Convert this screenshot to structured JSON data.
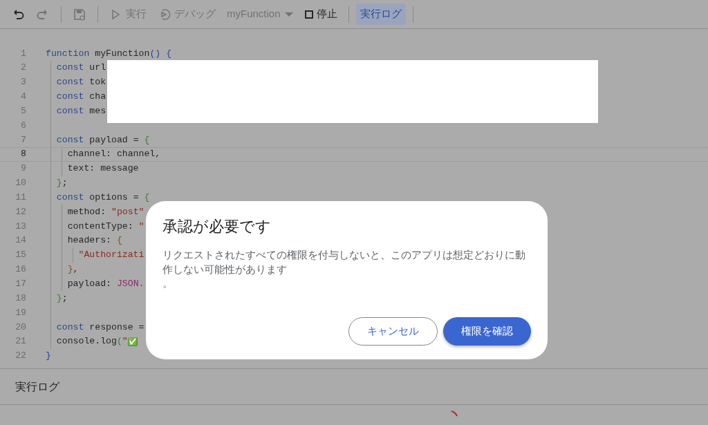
{
  "toolbar": [
    {
      "kind": "undo",
      "disabled": false
    },
    {
      "kind": "redo",
      "disabled": true
    },
    {
      "kind": "separator"
    },
    {
      "kind": "save",
      "disabled": true
    },
    {
      "kind": "separator"
    },
    {
      "kind": "run",
      "label": "実行",
      "disabled": true
    },
    {
      "kind": "debug",
      "label": "デバッグ",
      "disabled": true
    },
    {
      "kind": "function-select",
      "label": "myFunction",
      "disabled": true
    },
    {
      "kind": "stop",
      "label": "停止",
      "disabled": false
    },
    {
      "kind": "separator"
    },
    {
      "kind": "log",
      "label": "実行ログ",
      "on": true
    },
    {
      "kind": "separator"
    }
  ],
  "editor": {
    "lines": [
      {
        "number": "1",
        "current": false,
        "tokens": [
          {
            "text": "function",
            "kind": "keyword"
          },
          {
            "text": " myFunction",
            "kind": "plain"
          },
          {
            "text": "()",
            "kind": "brace1"
          },
          {
            "text": " {",
            "kind": "brace1"
          }
        ]
      },
      {
        "number": "2",
        "current": false,
        "tokens": [
          {
            "text": "  const",
            "kind": "keyword"
          },
          {
            "text": " url",
            "kind": "plain"
          }
        ]
      },
      {
        "number": "3",
        "current": false,
        "tokens": [
          {
            "text": "  const",
            "kind": "keyword"
          },
          {
            "text": " tok",
            "kind": "plain"
          }
        ]
      },
      {
        "number": "4",
        "current": false,
        "tokens": [
          {
            "text": "  const",
            "kind": "keyword"
          },
          {
            "text": " cha",
            "kind": "plain"
          }
        ]
      },
      {
        "number": "5",
        "current": false,
        "tokens": [
          {
            "text": "  const",
            "kind": "keyword"
          },
          {
            "text": " mes",
            "kind": "plain"
          }
        ]
      },
      {
        "number": "6",
        "current": false
      },
      {
        "number": "7",
        "current": false,
        "tokens": [
          {
            "text": "  const",
            "kind": "keyword"
          },
          {
            "text": " payload =",
            "kind": "plain"
          },
          {
            "text": " {",
            "kind": "brace2"
          }
        ]
      },
      {
        "number": "8",
        "current": true,
        "tokens": [
          {
            "text": "    channel: channel,",
            "kind": "plain"
          }
        ]
      },
      {
        "number": "9",
        "current": false,
        "tokens": [
          {
            "text": "    text: message",
            "kind": "plain"
          }
        ]
      },
      {
        "number": "10",
        "current": false,
        "tokens": [
          {
            "text": "  }",
            "kind": "brace2"
          },
          {
            "text": ";",
            "kind": "plain"
          }
        ]
      },
      {
        "number": "11",
        "current": false,
        "tokens": [
          {
            "text": "  const",
            "kind": "keyword"
          },
          {
            "text": " options =",
            "kind": "plain"
          },
          {
            "text": " {",
            "kind": "brace2"
          }
        ]
      },
      {
        "number": "12",
        "current": false,
        "tokens": [
          {
            "text": "    method:",
            "kind": "plain"
          },
          {
            "text": " \"post\"",
            "kind": "string"
          }
        ]
      },
      {
        "number": "13",
        "current": false,
        "tokens": [
          {
            "text": "    contentType:",
            "kind": "plain"
          },
          {
            "text": " \"",
            "kind": "string"
          }
        ]
      },
      {
        "number": "14",
        "current": false,
        "tokens": [
          {
            "text": "    headers:",
            "kind": "plain"
          },
          {
            "text": " {",
            "kind": "brace3"
          }
        ]
      },
      {
        "number": "15",
        "current": false,
        "tokens": [
          {
            "text": "      \"Authorizati",
            "kind": "string"
          }
        ]
      },
      {
        "number": "16",
        "current": false,
        "tokens": [
          {
            "text": "    }",
            "kind": "brace3"
          },
          {
            "text": ",",
            "kind": "plain"
          }
        ]
      },
      {
        "number": "17",
        "current": false,
        "tokens": [
          {
            "text": "    payload:",
            "kind": "plain"
          },
          {
            "text": " JSON.",
            "kind": "global"
          }
        ]
      },
      {
        "number": "18",
        "current": false,
        "tokens": [
          {
            "text": "  }",
            "kind": "brace2"
          },
          {
            "text": ";",
            "kind": "plain"
          }
        ]
      },
      {
        "number": "19",
        "current": false
      },
      {
        "number": "20",
        "current": false,
        "tokens": [
          {
            "text": "  const",
            "kind": "keyword"
          },
          {
            "text": " response =",
            "kind": "plain"
          }
        ]
      },
      {
        "number": "21",
        "current": false,
        "tokens": [
          {
            "text": "  console.log",
            "kind": "plain"
          },
          {
            "text": "(",
            "kind": "brace2"
          },
          {
            "text": "\"",
            "kind": "string"
          },
          {
            "text": "✅",
            "kind": "emoji"
          }
        ]
      },
      {
        "number": "22",
        "current": false,
        "tokens": [
          {
            "text": "}",
            "kind": "brace1"
          }
        ]
      }
    ],
    "redaction_overlay": {
      "shown": true
    }
  },
  "log_panel": {
    "title": "実行ログ",
    "loading": true
  },
  "dialog": {
    "title": "承認が必要です",
    "paragraphs": [
      "リクエストされたすべての権限を付与しないと、このアプリは想定どおりに動作しない可能性があります",
      "。"
    ],
    "buttons": [
      {
        "label": "キャンセル",
        "kind": "outline"
      },
      {
        "label": "権限を確認",
        "kind": "primary"
      }
    ]
  }
}
